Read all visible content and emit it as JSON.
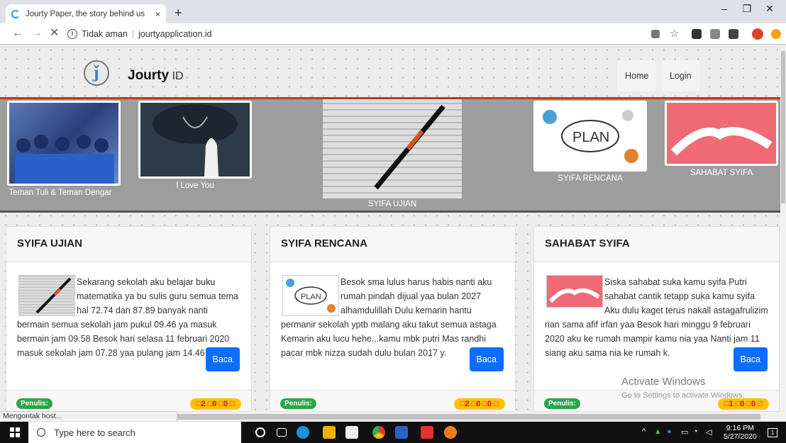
{
  "browser": {
    "tab_title": "Jourty Paper, the story behind us",
    "tab_close": "×",
    "new_tab": "+",
    "minimize": "–",
    "maximize": "❐",
    "close": "✕",
    "back": "←",
    "forward": "→",
    "stop": "✕",
    "security_label": "Tidak aman",
    "url": "jourtyapplication.id",
    "status_text": "Mengontak host..."
  },
  "site": {
    "logo_glyph": "ǰ",
    "brand_main": "Jourty",
    "brand_suffix": " ID",
    "nav": [
      {
        "label": "Home"
      },
      {
        "label": "Login"
      }
    ]
  },
  "carousel": [
    {
      "caption": "Teman Tuli & Teman Dengar"
    },
    {
      "caption": "I Love You"
    },
    {
      "caption": "SYIFA UJIAN"
    },
    {
      "caption": "SYIFA RENCANA"
    },
    {
      "caption": "SAHABAT SYIFA"
    }
  ],
  "cards": [
    {
      "title": "SYIFA UJIAN",
      "text": "Sekarang sekolah aku belajar buku matematika ya bu sulis guru semua tema hal 72.74 dan 87.89 banyak nanti bermain semua sekolah jam pukul 09.46 ya masuk bermain jam 09.58 Besok hari selasa 11 februari 2020 masuk sekolah jam 07.28 yaa pulang jam 14.46 Ruma.",
      "button": "Baca",
      "author_label": "Penulis:",
      "stats": "□2 □0 □0 □"
    },
    {
      "title": "SYIFA RENCANA",
      "text": "Besok sma lulus harus habis nanti aku rumah pindah dijual yaa bulan 2027 alhamdulillah  Dulu kemarin hantu permanir sekolah yptb malang aku takut semua astaga Kemarin aku lucu hehe...kamu mbk putri Mas randhi pacar mbk nizza sudah dulu bulan 2017 y.",
      "button": "Baca",
      "author_label": "Penulis:",
      "stats": "□2 □0 □0 □"
    },
    {
      "title": "SAHABAT SYIFA",
      "text": "Siska sahabat suka kamu syifa Putri sahabat cantik tetapp suka kamu syifa Aku dulu kaget terus nakall astagafrulizim rian sama afif irfan yaa Besok hari minggu 9 februari 2020 aku ke rumah mampir kamu nia yaa Nanti jam 11 siang aku sama nia ke rumah k.",
      "button": "Baca",
      "author_label": "Penulis:",
      "stats": "□1 □0 □0 □"
    }
  ],
  "watermark": {
    "title": "Activate Windows",
    "subtitle": "Go to Settings to activate Windows."
  },
  "taskbar": {
    "search_placeholder": "Type here to search",
    "time": "9:16 PM",
    "date": "5/27/2020",
    "notif_count": "1"
  },
  "colors": {
    "accent_red": "#c23a13",
    "primary": "#0d6efd",
    "success": "#28a745",
    "warning": "#ffc107"
  }
}
